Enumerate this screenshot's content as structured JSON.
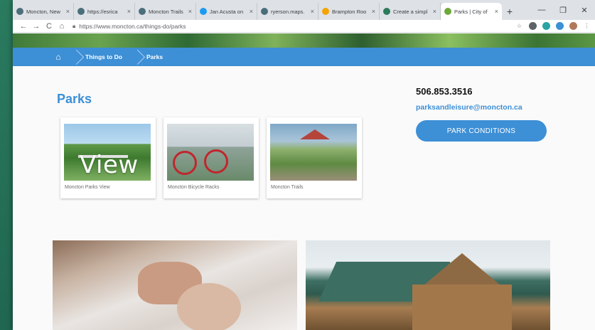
{
  "browser": {
    "tabs": [
      {
        "label": "Moncton, New",
        "fav_color": "#4a6f7a",
        "active": false
      },
      {
        "label": "https://esrica",
        "fav_color": "#4a6f7a",
        "active": false
      },
      {
        "label": "Moncton Trails",
        "fav_color": "#4a6f7a",
        "active": false
      },
      {
        "label": "Jan Acusta on",
        "fav_color": "#1d9bf0",
        "active": false
      },
      {
        "label": "ryerson.maps.",
        "fav_color": "#4a6f7a",
        "active": false
      },
      {
        "label": "Brampton Roo",
        "fav_color": "#f4a300",
        "active": false
      },
      {
        "label": "Create a simpl",
        "fav_color": "#2c7a5a",
        "active": false
      },
      {
        "label": "Parks | City of",
        "fav_color": "#6fa83a",
        "active": true
      }
    ],
    "tab_close": "×",
    "new_tab": "+",
    "window_controls": {
      "minimize": "—",
      "restore": "❐",
      "close": "✕"
    },
    "url": "https://www.moncton.ca/things-do/parks",
    "nav": {
      "back": "←",
      "forward": "→",
      "reload": "C",
      "home": "⌂"
    }
  },
  "breadcrumb": {
    "home_icon": "⌂",
    "items": [
      "Things to Do",
      "Parks"
    ]
  },
  "page": {
    "title": "Parks",
    "cards": [
      {
        "caption": "Moncton Parks View",
        "overlay": "View"
      },
      {
        "caption": "Moncton Bicycle Racks"
      },
      {
        "caption": "Moncton Trails"
      }
    ],
    "contact": {
      "phone": "506.853.3516",
      "email": "parksandleisure@moncton.ca"
    },
    "button_label": "PARK CONDITIONS"
  },
  "colors": {
    "accent": "#3d8fd6",
    "tab_bar": "#dee1e6"
  }
}
